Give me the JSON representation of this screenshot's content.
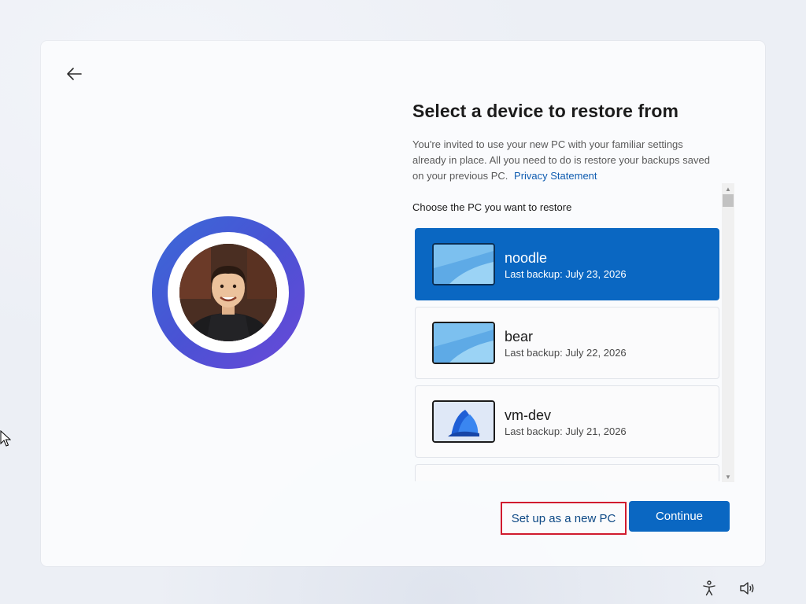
{
  "page": {
    "title": "Select a device to restore from",
    "description": "You're invited to use your new PC with your familiar settings already in place. All you need to do is restore your backups saved on your previous PC.",
    "privacy_link": "Privacy Statement",
    "choose_label": "Choose the PC you want to restore"
  },
  "devices": [
    {
      "name": "noodle",
      "backup": "Last backup: July 23, 2026",
      "selected": true,
      "thumbnail": "windows-wallpaper-light"
    },
    {
      "name": "bear",
      "backup": "Last backup: July 22, 2026",
      "selected": false,
      "thumbnail": "windows-wallpaper-light"
    },
    {
      "name": "vm-dev",
      "backup": "Last backup: July 21, 2026",
      "selected": false,
      "thumbnail": "windows-bloom-wallpaper"
    },
    {
      "name": "",
      "backup": "",
      "selected": false,
      "thumbnail": "windows-wallpaper-dark"
    }
  ],
  "buttons": {
    "setup_new": "Set up as a new PC",
    "continue": "Continue"
  },
  "icons": {
    "back": "arrow-left-icon",
    "accessibility": "accessibility-icon",
    "volume": "volume-icon"
  },
  "colors": {
    "accent": "#0a67c2",
    "highlight_border": "#d11b2e",
    "link": "#0f5cb0"
  }
}
